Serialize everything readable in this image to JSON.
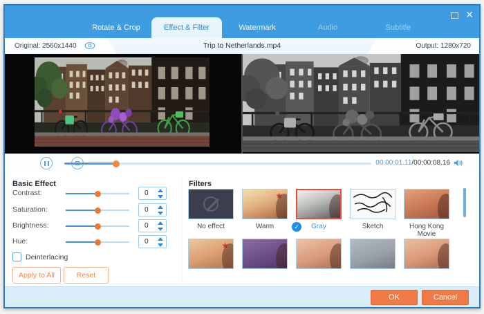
{
  "window": {
    "tabs": [
      {
        "label": "Rotate & Crop",
        "active": false
      },
      {
        "label": "Effect & Filter",
        "active": true
      },
      {
        "label": "Watermark",
        "active": false
      },
      {
        "label": "Audio",
        "active": false
      },
      {
        "label": "Subtitle",
        "active": false
      }
    ],
    "controls": {
      "maximize": "maximize",
      "close": "close"
    }
  },
  "info_bar": {
    "original": "Original: 2560x1440",
    "filename": "Trip to Netherlands.mp4",
    "output": "Output: 1280x720"
  },
  "player": {
    "current_time": "00:00:01.11",
    "separator": "/",
    "total_time": "00:00:08.16",
    "progress_percent": 17
  },
  "basic_effect": {
    "title": "Basic Effect",
    "rows": [
      {
        "label": "Contrast:",
        "value": "0"
      },
      {
        "label": "Saturation:",
        "value": "0"
      },
      {
        "label": "Brightness:",
        "value": "0"
      },
      {
        "label": "Hue:",
        "value": "0"
      }
    ],
    "deinterlacing_label": "Deinterlacing",
    "apply_all_label": "Apply to All",
    "reset_label": "Reset"
  },
  "filters": {
    "title": "Filters",
    "items": [
      {
        "label": "No effect",
        "selected": false
      },
      {
        "label": "Warm",
        "selected": false
      },
      {
        "label": "Gray",
        "selected": true
      },
      {
        "label": "Sketch",
        "selected": false
      },
      {
        "label": "Hong Kong Movie",
        "selected": false
      }
    ],
    "second_row_thumbnails": 5,
    "check_glyph": "✓"
  },
  "footer": {
    "ok_label": "OK",
    "cancel_label": "Cancel"
  },
  "colors": {
    "titlebar_blue": "#3d9ce2",
    "accent_blue": "#3f97d6",
    "accent_orange": "#ee7644",
    "selected_filter_border": "#e8512c",
    "footer_bg": "#d9ecf9"
  }
}
